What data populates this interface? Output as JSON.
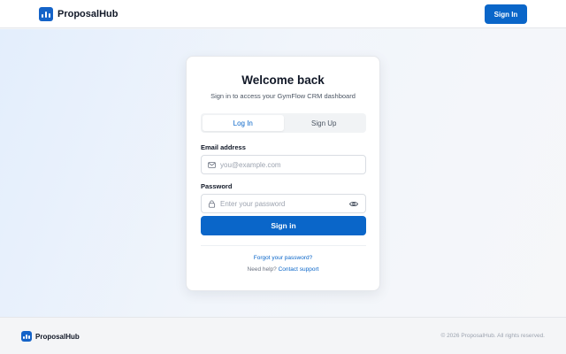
{
  "header": {
    "brand": "ProposalHub",
    "signin_label": "Sign In"
  },
  "card": {
    "title": "Welcome back",
    "subtitle": "Sign in to access your GymFlow CRM dashboard",
    "tabs": [
      {
        "label": "Log In",
        "active": true
      },
      {
        "label": "Sign Up",
        "active": false
      }
    ],
    "email": {
      "label": "Email address",
      "placeholder": "you@example.com",
      "value": "",
      "icon": "mail-icon"
    },
    "password": {
      "label": "Password",
      "placeholder": "Enter your password",
      "value": "",
      "icon": "lock-icon",
      "toggle_icon": "eye-icon"
    },
    "submit_label": "Sign in",
    "forgot_label": "Forgot your password?",
    "help_text": "Need help?",
    "help_link": "Contact support"
  },
  "footer": {
    "brand": "ProposalHub",
    "copyright": "© 2026 ProposalHub. All rights reserved."
  },
  "colors": {
    "primary": "#0a66c9",
    "text": "#111827",
    "muted": "#6b7280",
    "border": "#d9dde3"
  }
}
